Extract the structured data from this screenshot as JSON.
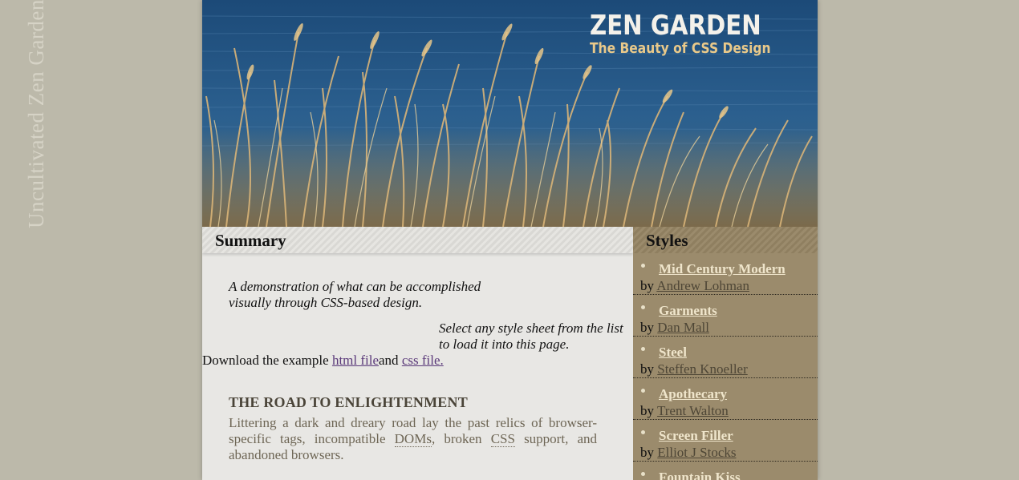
{
  "side_title": "Uncultivated Zen Garden",
  "header": {
    "title": "ZEN GARDEN",
    "subtitle": "The Beauty of CSS Design"
  },
  "summary": {
    "heading": "Summary",
    "intro_1": "A demonstration of what can be accomplished visually through CSS-based design.",
    "intro_2": "Select any style sheet from the list to load it into this page.",
    "download_prefix": "Download the example ",
    "html_link": "html file",
    "and_text": "and ",
    "css_link": "css file."
  },
  "road": {
    "heading": "THE ROAD TO ENLIGHTENMENT",
    "text_before_doms": "Littering a dark and dreary road lay the past relics of browser-specific tags, incompatible ",
    "doms": "DOMs",
    "text_mid": ", broken ",
    "css": "CSS",
    "text_after": " support, and abandoned browsers."
  },
  "styles": {
    "heading": "Styles",
    "by_label": "by ",
    "items": [
      {
        "name": "Mid Century Modern",
        "author": "Andrew Lohman"
      },
      {
        "name": "Garments",
        "author": "Dan Mall"
      },
      {
        "name": "Steel",
        "author": "Steffen Knoeller"
      },
      {
        "name": "Apothecary",
        "author": "Trent Walton"
      },
      {
        "name": "Screen Filler",
        "author": "Elliot J Stocks"
      },
      {
        "name": "Fountain Kiss",
        "author": ""
      }
    ]
  },
  "colors": {
    "page_background": "#bcb9aa",
    "content_background": "#e8e7e4",
    "sidebar_background": "#9b8b6c",
    "style_link": "#efe5cb",
    "visited_link": "#5b3a7a"
  }
}
